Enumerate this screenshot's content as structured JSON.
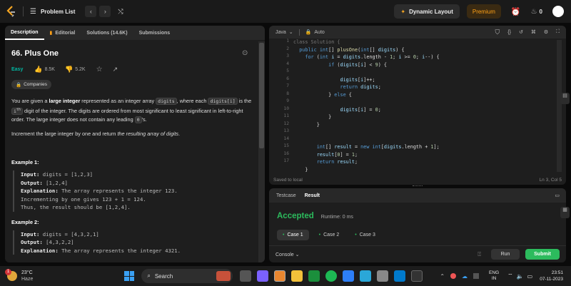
{
  "topbar": {
    "title": "Problem List",
    "layout_label": "Dynamic Layout",
    "premium_label": "Premium",
    "streak": "0"
  },
  "left_tabs": [
    "Description",
    "Editorial",
    "Solutions (14.6K)",
    "Submissions"
  ],
  "problem": {
    "title": "66. Plus One",
    "difficulty": "Easy",
    "likes": "8.5K",
    "dislikes": "5.2K",
    "tag": "Companies",
    "p1_a": "You are given a ",
    "p1_b": "large integer",
    "p1_c": " represented as an integer array ",
    "p1_d": "digits",
    "p1_e": ", where each ",
    "p1_f": "digits[i]",
    "p1_g": " is the ",
    "p1_h": "i",
    "p1_i": "th",
    "p1_j": " digit of the integer. The digits are ordered from most significant to least significant in left-to-right order. The large integer does not contain any leading ",
    "p1_k": "0",
    "p1_l": "'s.",
    "p2_a": "Increment the large integer by one and return ",
    "p2_b": "the resulting array of digits",
    "p2_c": ".",
    "ex1_title": "Example 1:",
    "ex1_l1a": "Input:",
    "ex1_l1b": " digits = [1,2,3]",
    "ex1_l2a": "Output:",
    "ex1_l2b": " [1,2,4]",
    "ex1_l3a": "Explanation:",
    "ex1_l3b": " The array represents the integer 123.",
    "ex1_l4": "Incrementing by one gives 123 + 1 = 124.",
    "ex1_l5": "Thus, the result should be [1,2,4].",
    "ex2_title": "Example 2:",
    "ex2_l1a": "Input:",
    "ex2_l1b": " digits = [4,3,2,1]",
    "ex2_l2a": "Output:",
    "ex2_l2b": " [4,3,2,2]",
    "ex2_l3a": "Explanation:",
    "ex2_l3b": " The array represents the integer 4321."
  },
  "editor": {
    "language": "Java",
    "mode": "Auto",
    "status_left": "Saved to local",
    "status_right": "Ln 3, Col 5",
    "line_numbers": [
      "1",
      "2",
      "3",
      "4",
      "5",
      "6",
      "7",
      "8",
      "9",
      "10",
      "11",
      "12",
      "13",
      "14",
      "15",
      "16",
      "17"
    ]
  },
  "result": {
    "tabs": [
      "Testcase",
      "Result"
    ],
    "verdict": "Accepted",
    "runtime": "Runtime: 0 ms",
    "cases": [
      "Case 1",
      "Case 2",
      "Case 3"
    ],
    "console_label": "Console",
    "run_label": "Run",
    "submit_label": "Submit"
  },
  "taskbar": {
    "temp": "23°C",
    "weather": "Haze",
    "search": "Search",
    "lang1": "ENG",
    "lang2": "IN",
    "time": "23:51",
    "date": "07-11-2023",
    "notif": "1"
  }
}
